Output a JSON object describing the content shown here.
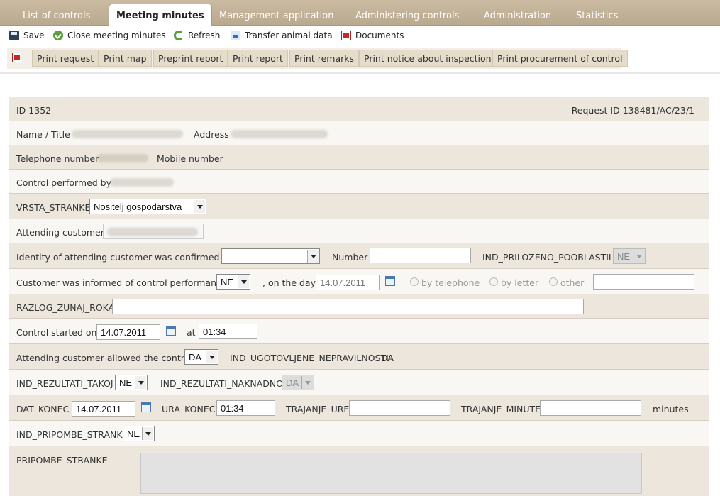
{
  "tabs": [
    {
      "label": "List of controls"
    },
    {
      "label": "Meeting minutes"
    },
    {
      "label": "Management application"
    },
    {
      "label": "Administering controls"
    },
    {
      "label": "Administration"
    },
    {
      "label": "Statistics"
    }
  ],
  "toolbar": {
    "save": "Save",
    "close": "Close meeting minutes",
    "refresh": "Refresh",
    "transfer": "Transfer animal data",
    "documents": "Documents"
  },
  "print_buttons": [
    "Print request",
    "Print map",
    "Preprint report",
    "Print report",
    "Print remarks",
    "Print notice about inspection",
    "Print procurement of control"
  ],
  "form": {
    "id": "ID 1352",
    "request_id": "Request ID 138481/AC/23/1",
    "name_label": "Name / Title",
    "address_label": "Address",
    "telephone_label": "Telephone number",
    "mobile_label": "Mobile number",
    "performed_by_label": "Control performed by",
    "vrsta_label": "VRSTA_STRANKE",
    "vrsta_value": "Nositelj gospodarstva",
    "attending_label": "Attending customer",
    "identity_label": "Identity of attending customer was confirmed by",
    "identity_value": "",
    "number_label": "Number",
    "number_value": "",
    "priloz_label": "IND_PRILOZENO_POOBLASTILO",
    "priloz_value": "NE",
    "informed_label": "Customer was informed of control performance",
    "informed_value": "NE",
    "on_day_label": ", on the day",
    "on_day_value": "14.07.2011",
    "radio_telephone": "by telephone",
    "radio_letter": "by letter",
    "radio_other": "other",
    "other_value": "",
    "razlog_label": "RAZLOG_ZUNAJ_ROKA",
    "razlog_value": "",
    "started_label": "Control started on",
    "started_date": "14.07.2011",
    "at_label": "at",
    "started_time": "01:34",
    "allowed_label": "Attending customer allowed the control",
    "allowed_value": "DA",
    "ugot_label": "IND_UGOTOVLJENE_NEPRAVILNOSTI",
    "ugot_value": "DA",
    "rez_takoj_label": "IND_REZULTATI_TAKOJ",
    "rez_takoj_value": "NE",
    "rez_nak_label": "IND_REZULTATI_NAKNADNO",
    "rez_nak_value": "DA",
    "dat_konec_label": "DAT_KONEC",
    "dat_konec_value": "14.07.2011",
    "ura_konec_label": "URA_KONEC",
    "ura_konec_value": "01:34",
    "trajanje_ure_label": "TRAJANJE_URE",
    "trajanje_ure_value": "",
    "trajanje_min_label": "TRAJANJE_MINUTE",
    "trajanje_min_value": "",
    "minutes_label": "minutes",
    "pripombe_ind_label": "IND_PRIPOMBE_STRANKE",
    "pripombe_ind_value": "NE",
    "pripombe_label": "PRIPOMBE_STRANKE"
  }
}
